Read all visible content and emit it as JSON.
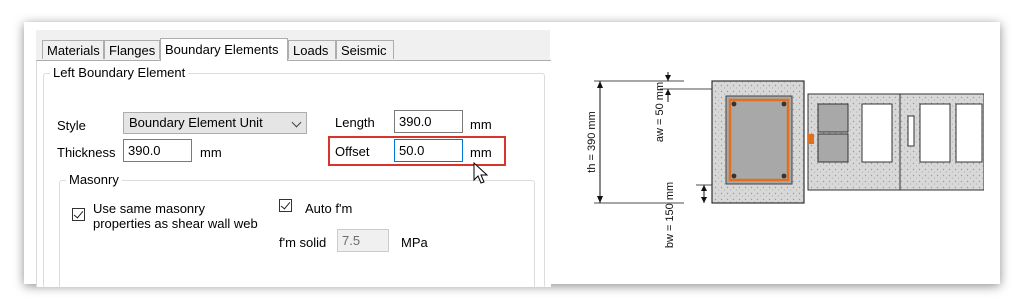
{
  "tabs": [
    {
      "label": "Materials",
      "active": false
    },
    {
      "label": "Flanges",
      "active": false
    },
    {
      "label": "Boundary Elements",
      "active": true
    },
    {
      "label": "Loads",
      "active": false
    },
    {
      "label": "Seismic",
      "active": false
    }
  ],
  "left_boundary": {
    "title": "Left Boundary Element",
    "style_label": "Style",
    "style_value": "Boundary Element Unit",
    "thickness_label": "Thickness",
    "thickness_value": "390.0",
    "thickness_unit": "mm",
    "length_label": "Length",
    "length_value": "390.0",
    "length_unit": "mm",
    "offset_label": "Offset",
    "offset_value": "50.0",
    "offset_unit": "mm"
  },
  "masonry": {
    "title": "Masonry",
    "same_props_label_line1": "Use same masonry",
    "same_props_label_line2": "properties as shear wall web",
    "same_props_checked": true,
    "auto_fm_label": "Auto f'm",
    "auto_fm_checked": true,
    "fm_solid_label": "f'm solid",
    "fm_solid_value": "7.5",
    "fm_solid_unit": "MPa"
  },
  "diagram": {
    "th_label": "th = 390 mm",
    "aw_label": "aw = 50 mm",
    "bw_label": "bw = 150 mm"
  },
  "colors": {
    "highlight": "#d9342b",
    "focus": "#0078d7",
    "rebar": "#e07020"
  }
}
